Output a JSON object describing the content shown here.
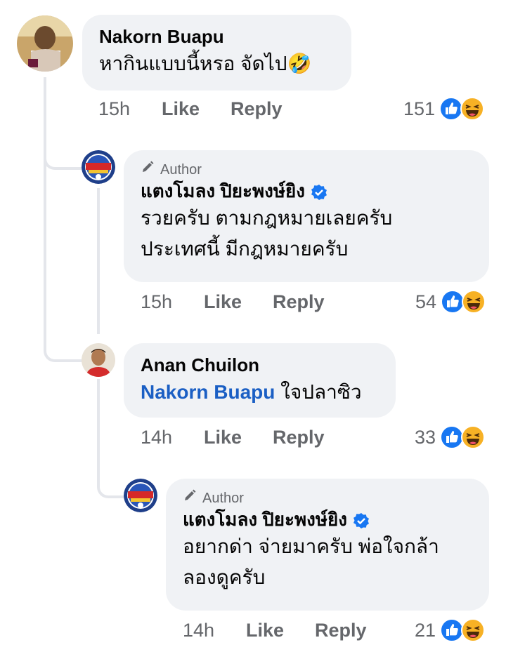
{
  "comments": [
    {
      "author": "Nakorn Buapu",
      "text": "หากินแบบนี้หรอ จัดไป",
      "emoji": "🤣",
      "time": "15h",
      "like_label": "Like",
      "reply_label": "Reply",
      "reaction_count": "151"
    },
    {
      "author_tag": "Author",
      "author": "แตงโมลง ปิยะพงษ์ยิง",
      "text": "รวยครับ ตามกฎหมายเลยครับ\nประเทศนี้ มีกฎหมายครับ",
      "time": "15h",
      "like_label": "Like",
      "reply_label": "Reply",
      "reaction_count": "54"
    },
    {
      "author": "Anan Chuilon",
      "mention": "Nakorn Buapu",
      "text": "ใจปลาซิว",
      "time": "14h",
      "like_label": "Like",
      "reply_label": "Reply",
      "reaction_count": "33"
    },
    {
      "author_tag": "Author",
      "author": "แตงโมลง ปิยะพงษ์ยิง",
      "text": "อยากด่า จ่ายมาครับ พ่อใจกล้า\nลองดูครับ",
      "time": "14h",
      "like_label": "Like",
      "reply_label": "Reply",
      "reaction_count": "21"
    }
  ],
  "icons": {
    "verified": "verified-badge-icon",
    "author": "pencil-icon",
    "reactions": [
      "like-reaction-icon",
      "haha-reaction-icon"
    ]
  },
  "colors": {
    "bubble": "#f0f2f5",
    "meta": "#65676b",
    "mention": "#1b5fc4",
    "like_blue": "#1877f2",
    "haha_yellow": "#f7b125"
  }
}
